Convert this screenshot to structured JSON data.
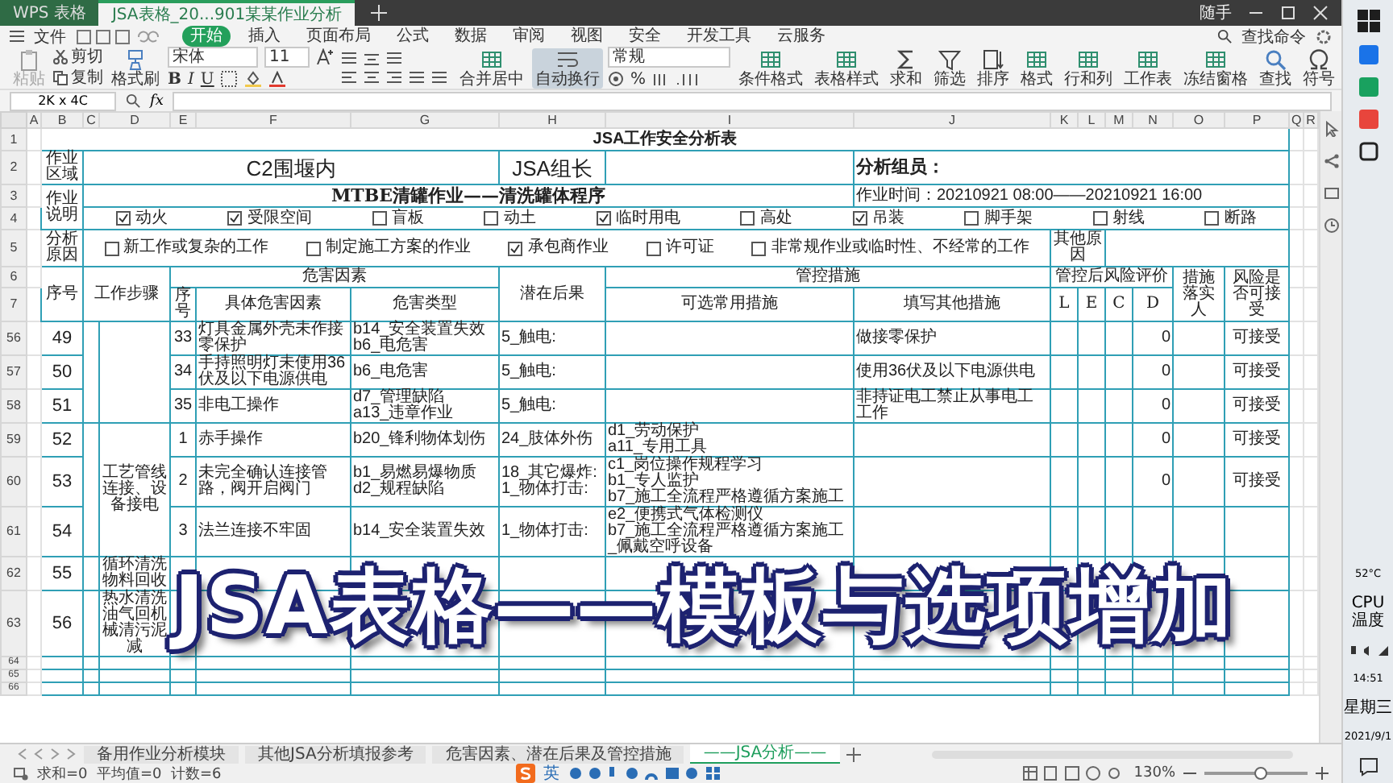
{
  "app_tabs": [
    {
      "label": "WPS 表格",
      "selected": false
    },
    {
      "label": "JSA表格_20...901某某作业分析",
      "selected": true
    }
  ],
  "account": "随手",
  "file_menu": "文件",
  "ribbon_tabs": [
    {
      "label": "开始",
      "selected": true
    },
    {
      "label": "插入",
      "selected": false
    },
    {
      "label": "页面布局",
      "selected": false
    },
    {
      "label": "公式",
      "selected": false
    },
    {
      "label": "数据",
      "selected": false
    },
    {
      "label": "审阅",
      "selected": false
    },
    {
      "label": "视图",
      "selected": false
    },
    {
      "label": "安全",
      "selected": false
    },
    {
      "label": "开发工具",
      "selected": false
    },
    {
      "label": "云服务",
      "selected": false
    }
  ],
  "command_search": "查找命令",
  "ribbon": [
    {
      "kind": "large",
      "label": "粘贴",
      "selected": false,
      "disabled": true
    },
    {
      "kind": "pair",
      "items": [
        "剪切",
        "复制"
      ]
    },
    {
      "kind": "large",
      "label": "格式刷",
      "selected": false,
      "disabled": false
    },
    {
      "kind": "font",
      "family": "宋体",
      "size": "11",
      "styles": [
        "B",
        "I",
        "U"
      ]
    },
    {
      "kind": "align"
    },
    {
      "kind": "large",
      "label": "合并居中",
      "selected": false,
      "disabled": false
    },
    {
      "kind": "large",
      "label": "自动换行",
      "selected": true,
      "disabled": false
    },
    {
      "kind": "number",
      "format": "常规",
      "symbol": "%"
    },
    {
      "kind": "large",
      "label": "条件格式",
      "selected": false,
      "disabled": false
    },
    {
      "kind": "large",
      "label": "表格样式",
      "selected": false,
      "disabled": false
    },
    {
      "kind": "large",
      "label": "求和",
      "selected": false,
      "disabled": false
    },
    {
      "kind": "large",
      "label": "筛选",
      "selected": false,
      "disabled": false
    },
    {
      "kind": "large",
      "label": "排序",
      "selected": false,
      "disabled": false
    },
    {
      "kind": "large",
      "label": "格式",
      "selected": false,
      "disabled": false
    },
    {
      "kind": "large",
      "label": "行和列",
      "selected": false,
      "disabled": false
    },
    {
      "kind": "large",
      "label": "工作表",
      "selected": false,
      "disabled": false
    },
    {
      "kind": "large",
      "label": "冻结窗格",
      "selected": false,
      "disabled": false
    },
    {
      "kind": "large",
      "label": "查找",
      "selected": false,
      "disabled": false
    },
    {
      "kind": "large",
      "label": "符号",
      "selected": false,
      "disabled": false
    }
  ],
  "formula_bar": {
    "name_box": "2K x 4C",
    "fx": "fx"
  },
  "columns": [
    "A",
    "B",
    "C",
    "D",
    "E",
    "F",
    "G",
    "H",
    "I",
    "J",
    "K",
    "L",
    "M",
    "N",
    "O",
    "P",
    "Q",
    "R"
  ],
  "sheet": {
    "header_row_numbers": [
      "1",
      "2",
      "3",
      "4",
      "5",
      "6",
      "7"
    ],
    "title": "JSA工作安全分析表",
    "area_label": "作业区域",
    "area": "C2围堰内",
    "leader_label": "JSA组长",
    "members_label": "分析组员：",
    "desc_label": "作业说明",
    "job": "MTBE清罐作业——清洗罐体程序",
    "time": "作业时间：20210921   08:00——20210921  16:00",
    "work_types": [
      {
        "label": "动火",
        "checked": true
      },
      {
        "label": "受限空间",
        "checked": true
      },
      {
        "label": "盲板",
        "checked": false
      },
      {
        "label": "动土",
        "checked": false
      },
      {
        "label": "临时用电",
        "checked": true
      },
      {
        "label": "高处",
        "checked": false
      },
      {
        "label": "吊装",
        "checked": true
      },
      {
        "label": "脚手架",
        "checked": false
      },
      {
        "label": "射线",
        "checked": false
      },
      {
        "label": "断路",
        "checked": false
      }
    ],
    "reason_label": "分析原因",
    "reasons": [
      {
        "label": "新工作或复杂的工作",
        "checked": false
      },
      {
        "label": "制定施工方案的作业",
        "checked": false
      },
      {
        "label": "承包商作业",
        "checked": true
      },
      {
        "label": "许可证",
        "checked": false
      },
      {
        "label": "非常规作业或临时性、不经常的工作",
        "checked": false
      }
    ],
    "other_reason_label": "其他原因",
    "headers": {
      "no": "序号",
      "step": "工作步骤",
      "hazards": "危害因素",
      "hazard_no": "序号",
      "hazard": "具体危害因素",
      "hazard_type": "危害类型",
      "consequence": "潜在后果",
      "controls": "管控措施",
      "common": "可选常用措施",
      "other": "填写其他措施",
      "risk": "管控后风险评价",
      "risk_cols": [
        "L",
        "E",
        "C",
        "D"
      ],
      "owner": "措施落实人",
      "acceptable": "风险是否可接受"
    },
    "steps": [
      {
        "rows": [
          {
            "row": "56",
            "no": "49",
            "hazard_no": "33",
            "hazard": "灯具金属外壳未作接零保护",
            "hazard_type": "b14_安全装置失效\nb6_电危害",
            "consequence": "5_触电:",
            "measures": "",
            "other_measures": "做接零保护",
            "d": "0",
            "acceptable": "可接受"
          },
          {
            "row": "57",
            "no": "50",
            "hazard_no": "34",
            "hazard": "手持照明灯未使用36伏及以下电源供电",
            "hazard_type": "b6_电危害",
            "consequence": "5_触电:",
            "measures": "",
            "other_measures": "使用36伏及以下电源供电",
            "d": "0",
            "acceptable": "可接受"
          },
          {
            "row": "58",
            "no": "51",
            "hazard_no": "35",
            "hazard": "非电工操作",
            "hazard_type": "d7_管理缺陷\na13_违章作业",
            "consequence": "5_触电:",
            "measures": "",
            "other_measures": "非持证电工禁止从事电工工作",
            "d": "0",
            "acceptable": "可接受"
          }
        ]
      },
      {
        "name": "工艺管线连接、设备接电",
        "rows": [
          {
            "row": "59",
            "no": "52",
            "hazard_no": "1",
            "hazard": "赤手操作",
            "hazard_type": "b20_锋利物体划伤",
            "consequence": "24_肢体外伤",
            "measures": "d1_劳动保护\na11_专用工具",
            "other_measures": "",
            "d": "0",
            "acceptable": "可接受"
          },
          {
            "row": "60",
            "no": "53",
            "hazard_no": "2",
            "hazard": "未完全确认连接管路，阀开启阀门",
            "hazard_type": "b1_易燃易爆物质\nd2_规程缺陷",
            "consequence": "18_其它爆炸:\n1_物体打击:",
            "measures": "c1_岗位操作规程学习\nb1_专人监护\nb7_施工全流程严格遵循方案施工",
            "other_measures": "",
            "d": "0",
            "acceptable": "可接受"
          },
          {
            "row": "61",
            "no": "54",
            "hazard_no": "3",
            "hazard": "法兰连接不牢固",
            "hazard_type": "b14_安全装置失效",
            "consequence": "1_物体打击:",
            "measures": "e2_便携式气体检测仪\nb7_施工全流程严格遵循方案施工\n_佩戴空呼设备",
            "other_measures": "",
            "d": "",
            "acceptable": ""
          }
        ]
      },
      {
        "name": "循环清洗物料回收",
        "rows": [
          {
            "row": "62",
            "no": "55"
          }
        ]
      },
      {
        "name": "热水清洗油气回机械清污泥减",
        "rows": [
          {
            "row": "63",
            "no": "56"
          }
        ]
      }
    ],
    "trailing_rows": [
      "64",
      "65",
      "66"
    ]
  },
  "overlay_caption": "JSA表格——模板与选项增加",
  "sheet_tabs": [
    {
      "label": "备用作业分析模块",
      "selected": false
    },
    {
      "label": "其他JSA分析填报参考",
      "selected": false
    },
    {
      "label": "危害因素、潜在后果及管控措施",
      "selected": false
    },
    {
      "label": "——JSA分析——",
      "selected": true
    }
  ],
  "status": {
    "summary": "求和=0  平均值=0  计数=6",
    "ime": "英",
    "zoom": "130%",
    "zoom_slider": {
      "level": 0.55
    }
  },
  "taskbar": {
    "temperature": "52°C",
    "temperature_label": "CPU温度",
    "time": "14:51",
    "weekday": "星期三",
    "date": "2021/9/1"
  }
}
